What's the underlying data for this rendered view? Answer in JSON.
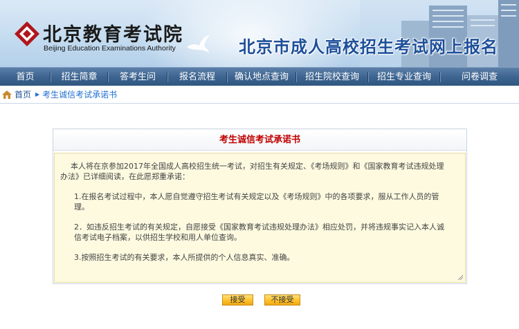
{
  "header": {
    "logo_cn": "北京教育考试院",
    "logo_en": "Beijing Education Examinations Authority",
    "site_title": "北京市成人高校招生考试网上报名"
  },
  "nav": {
    "items": [
      {
        "label": "首页"
      },
      {
        "label": "招生简章"
      },
      {
        "label": "答考生问"
      },
      {
        "label": "报名流程"
      },
      {
        "label": "确认地点查询"
      },
      {
        "label": "招生院校查询"
      },
      {
        "label": "招生专业查询"
      },
      {
        "label": "问卷调查"
      }
    ]
  },
  "breadcrumb": {
    "home": "首页",
    "current": "考生诚信考试承诺书"
  },
  "panel": {
    "title": "考生诚信考试承诺书",
    "intro": "本人将在京参加2017年全国成人高校招生统一考试，对招生有关规定、《考场规则》和《国家教育考试违规处理办法》已详细阅读，在此愿郑重承诺：",
    "item1": "1.在报名考试过程中，本人愿自觉遵守招生考试有关规定以及《考场规则》中的各项要求，服从工作人员的管理。",
    "item2": "2．如违反招生考试的有关规定，自愿接受《国家教育考试违规处理办法》相应处罚，并将违规事实记入本人诚信考试电子档案，以供招生学校和用人单位查询。",
    "item3": "3.按照招生考试的有关要求，本人所提供的个人信息真实、准确。"
  },
  "buttons": {
    "accept": "接受",
    "decline": "不接受"
  },
  "colors": {
    "nav_bg": "#3e6591",
    "title_red": "#c00000",
    "panel_bg": "#fdfae0",
    "button_gold": "#ffc12a",
    "site_title_blue": "#1d4f9a"
  }
}
